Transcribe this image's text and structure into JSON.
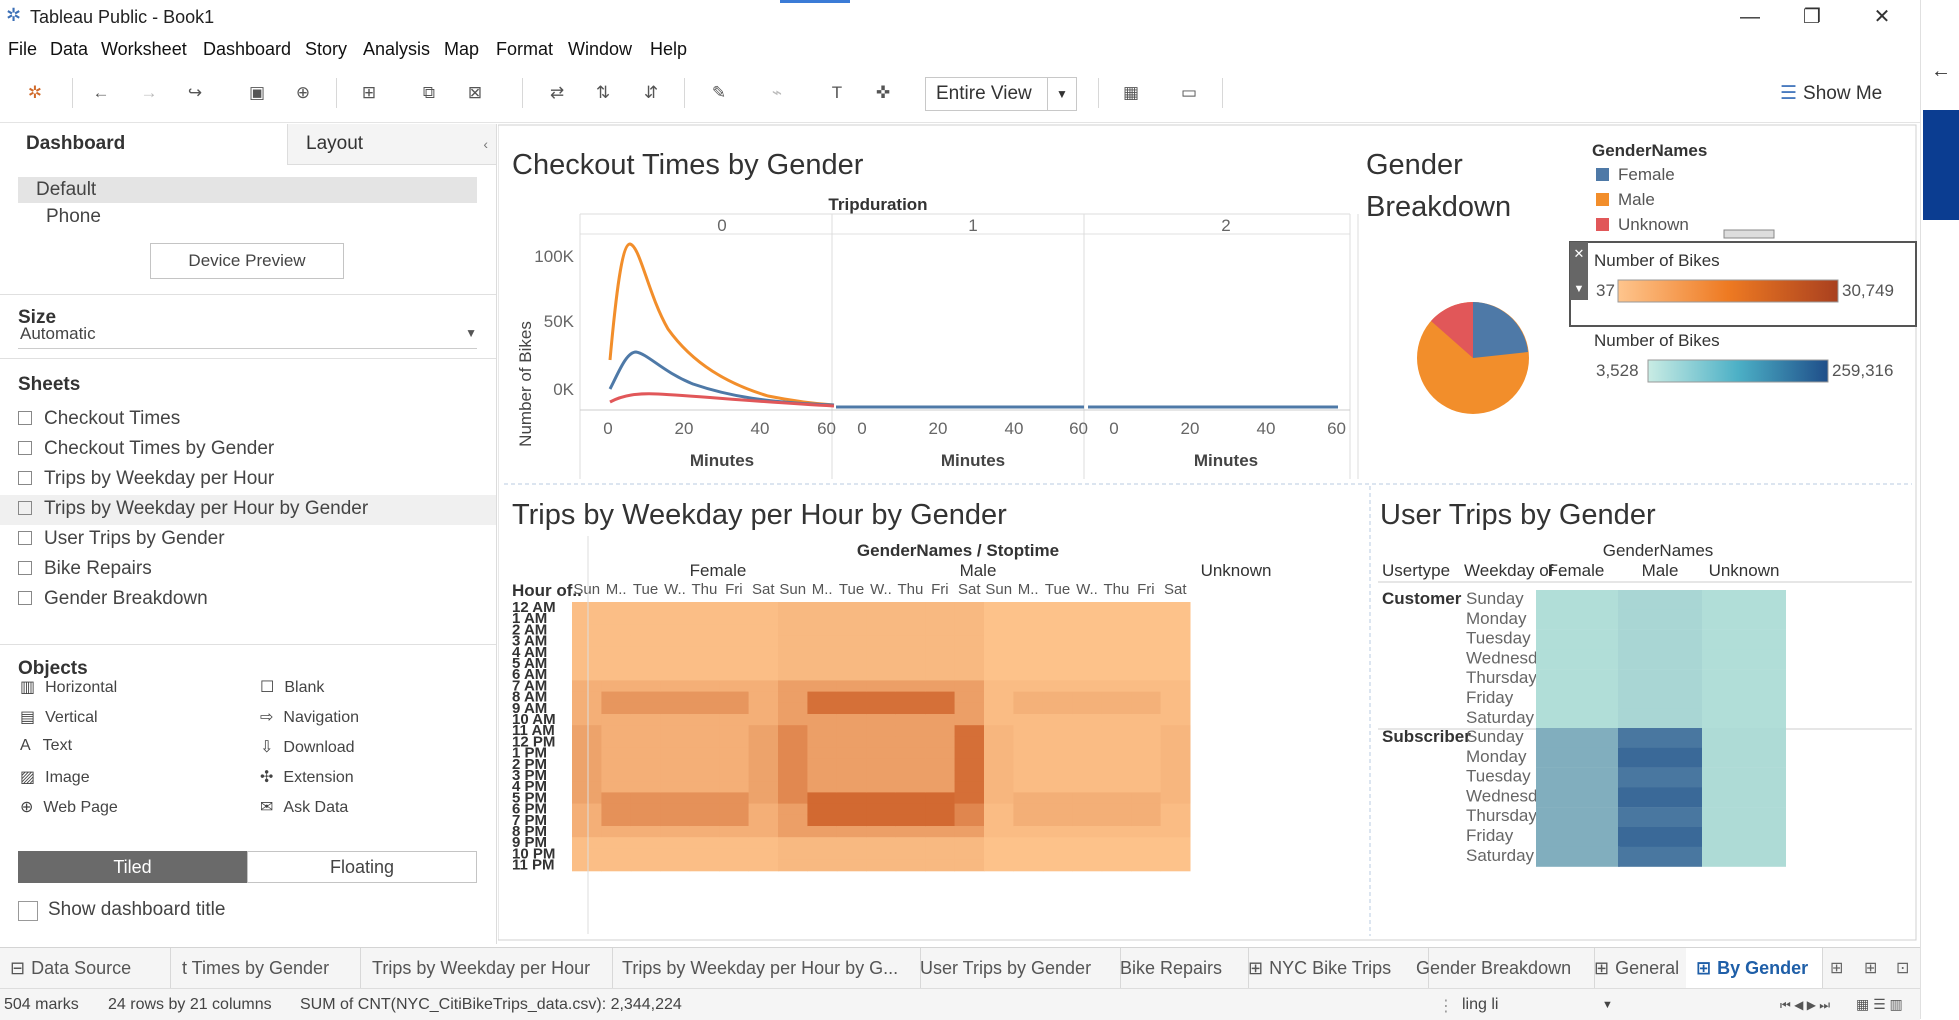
{
  "window": {
    "title": "Tableau Public - Book1"
  },
  "menu": [
    "File",
    "Data",
    "Worksheet",
    "Dashboard",
    "Story",
    "Analysis",
    "Map",
    "Format",
    "Window",
    "Help"
  ],
  "toolbar": {
    "view_select": "Entire View",
    "show_me": "Show Me"
  },
  "left_panel": {
    "tabs": [
      "Dashboard",
      "Layout"
    ],
    "device_options": [
      "Default",
      "Phone"
    ],
    "device_preview": "Device Preview",
    "size_heading": "Size",
    "size_value": "Automatic",
    "sheets_heading": "Sheets",
    "sheets": [
      "Checkout Times",
      "Checkout Times by Gender",
      "Trips by Weekday per Hour",
      "Trips by Weekday per Hour by Gender",
      "User Trips by Gender",
      "Bike Repairs",
      "Gender Breakdown"
    ],
    "objects_heading": "Objects",
    "objects_left": [
      "Horizontal",
      "Vertical",
      "Text",
      "Image",
      "Web Page"
    ],
    "objects_right": [
      "Blank",
      "Navigation",
      "Download",
      "Extension",
      "Ask Data"
    ],
    "tiled": "Tiled",
    "floating": "Floating",
    "show_title": "Show dashboard title"
  },
  "checkout": {
    "title": "Checkout Times by Gender",
    "col_header": "Tripduration",
    "panes": [
      "0",
      "1",
      "2"
    ],
    "ylabel": "Number of Bikes",
    "xlabel": "Minutes",
    "yticks": [
      "100K",
      "50K",
      "0K"
    ],
    "xticks": [
      "0",
      "20",
      "40",
      "60"
    ]
  },
  "gender": {
    "title_line1": "Gender",
    "title_line2": "Breakdown",
    "legend_title": "GenderNames",
    "legend": [
      {
        "name": "Female",
        "color": "#4e79a7"
      },
      {
        "name": "Male",
        "color": "#f28e2b"
      },
      {
        "name": "Unknown",
        "color": "#e15759"
      }
    ],
    "bikes_legend1": {
      "title": "Number of Bikes",
      "min": "37",
      "max": "30,749"
    },
    "bikes_legend2": {
      "title": "Number of Bikes",
      "min": "3,528",
      "max": "259,316"
    }
  },
  "heatmap": {
    "title": "Trips by Weekday per Hour by Gender",
    "col_header": "GenderNames / Stoptime",
    "groups": [
      "Female",
      "Male",
      "Unknown"
    ],
    "days": [
      "Sun",
      "M..",
      "Tue",
      "W..",
      "Thu",
      "Fri",
      "Sat"
    ],
    "row_header": "Hour of..",
    "hours": [
      "12 AM",
      "1 AM",
      "2 AM",
      "3 AM",
      "4 AM",
      "5 AM",
      "6 AM",
      "7 AM",
      "8 AM",
      "9 AM",
      "10 AM",
      "11 AM",
      "12 PM",
      "1 PM",
      "2 PM",
      "3 PM",
      "4 PM",
      "5 PM",
      "6 PM",
      "7 PM",
      "8 PM",
      "9 PM",
      "10 PM",
      "11 PM"
    ]
  },
  "usertrips": {
    "title": "User Trips by Gender",
    "col_header": "GenderNames",
    "row_headers": [
      "Usertype",
      "Weekday of .."
    ],
    "cols": [
      "Female",
      "Male",
      "Unknown"
    ],
    "usertypes": [
      "Customer",
      "Subscriber"
    ],
    "days": [
      "Sunday",
      "Monday",
      "Tuesday",
      "Wednesday",
      "Thursday",
      "Friday",
      "Saturday"
    ]
  },
  "bottom_tabs": [
    "Data Source",
    "t Times by Gender",
    "Trips by Weekday per Hour",
    "Trips by Weekday per Hour by G...",
    "User Trips by Gender",
    "Bike Repairs",
    "NYC Bike Trips",
    "Gender Breakdown",
    "General",
    "By Gender"
  ],
  "status": {
    "marks": "504 marks",
    "dims": "24 rows by 21 columns",
    "sum": "SUM of CNT(NYC_CitiBikeTrips_data.csv): 2,344,224",
    "user": "ling li"
  },
  "colors": {
    "accent": "#1f5fa8",
    "heat_low": "#fec58d",
    "heat_high": "#c34a12",
    "blue_low": "#b5e2da",
    "blue_high": "#1f4e89"
  }
}
